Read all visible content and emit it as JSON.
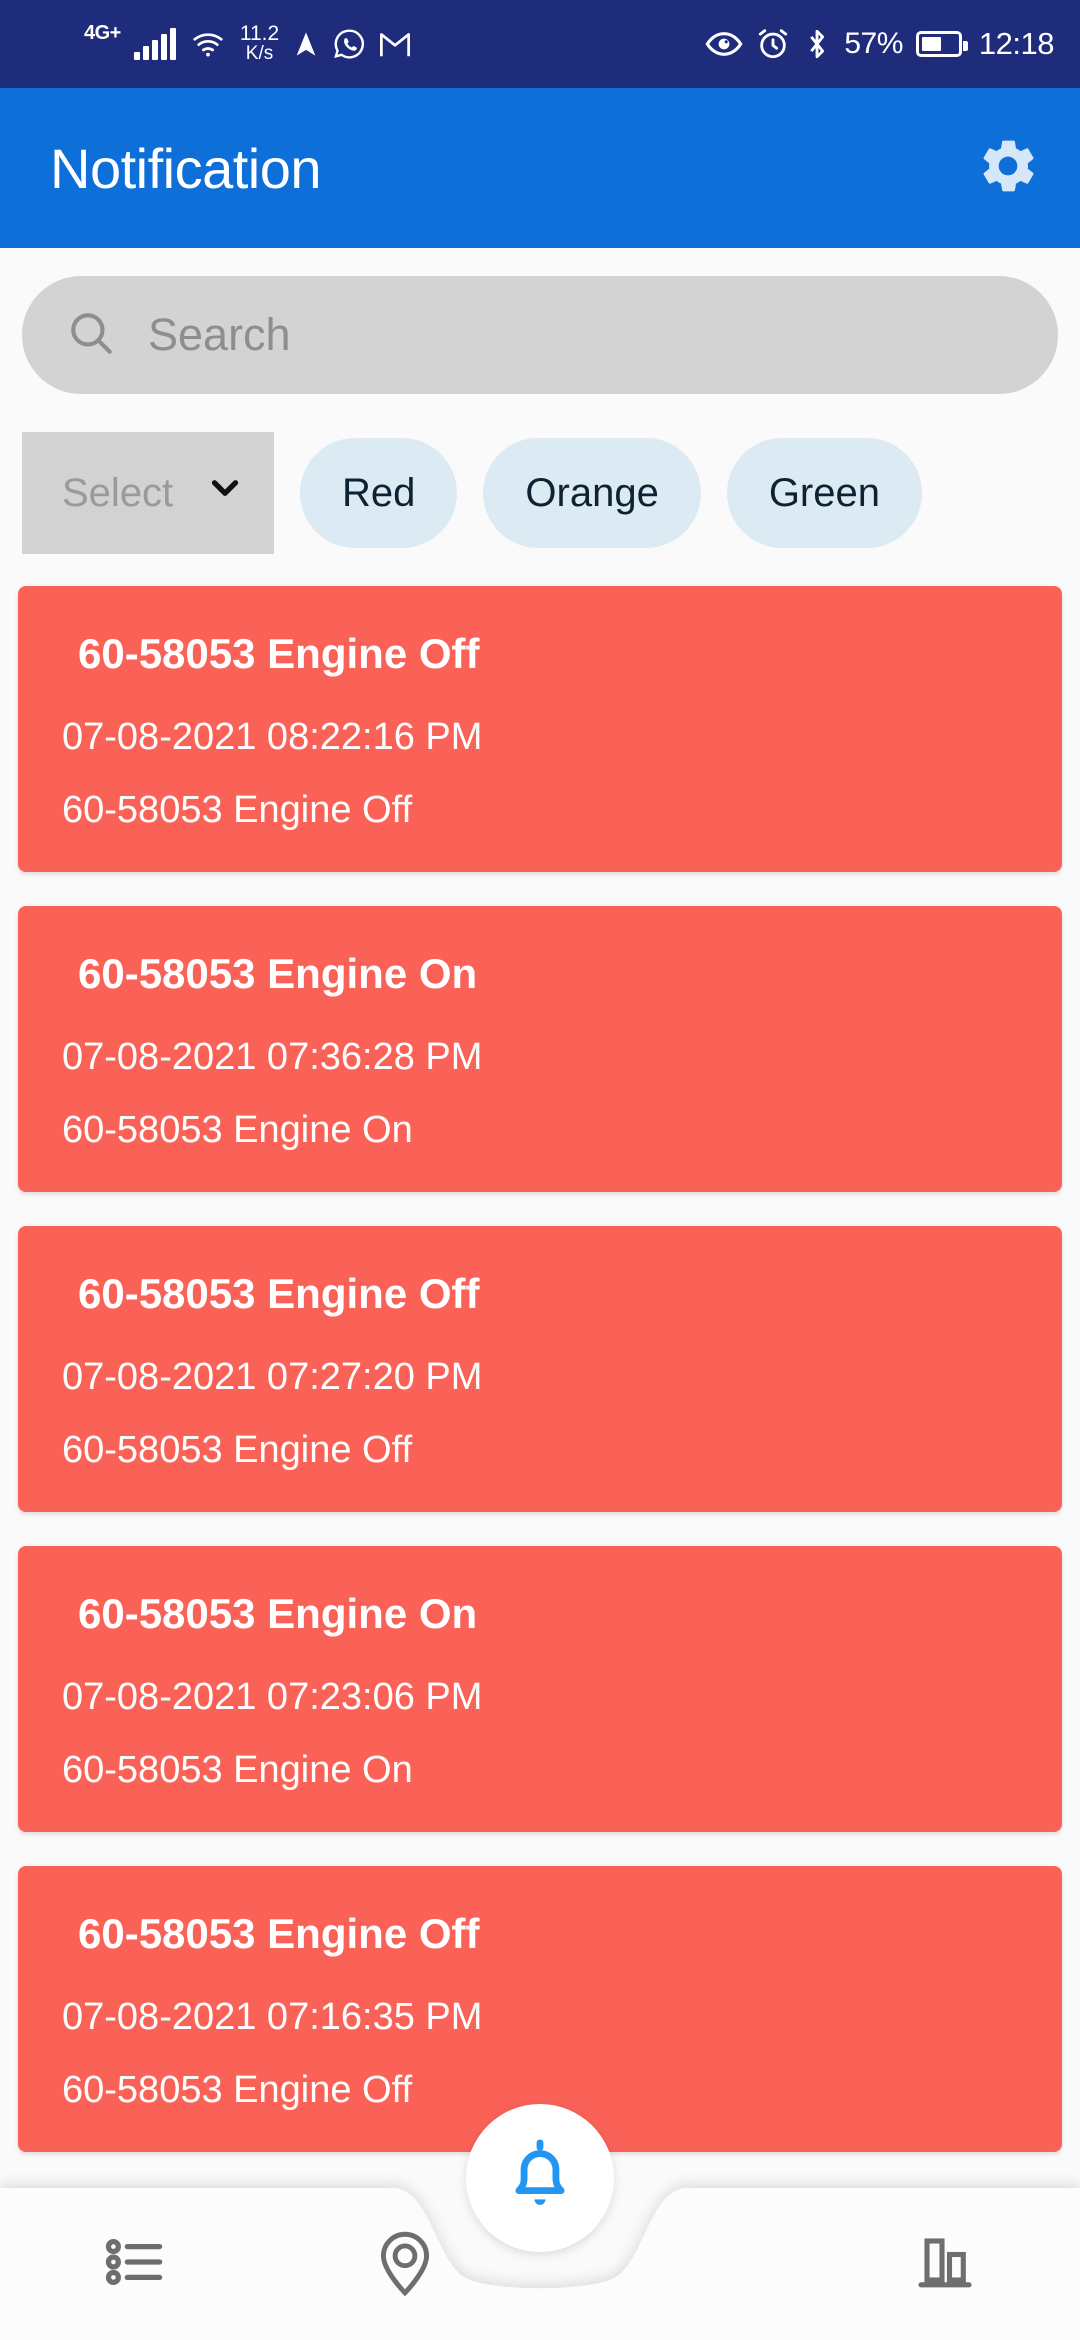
{
  "statusbar": {
    "network_label": "4G+",
    "signal_icon": "signal-bars-icon",
    "wifi_icon": "wifi-icon",
    "data_speed_value": "11.2",
    "data_speed_unit": "K/s",
    "navigation_icon": "navigation-arrow-icon",
    "whatsapp_icon": "whatsapp-icon",
    "gmail_icon": "gmail-icon",
    "eye_icon": "eye-icon",
    "alarm_icon": "alarm-clock-icon",
    "bluetooth_icon": "bluetooth-icon",
    "battery_percent": "57%",
    "battery_icon": "battery-icon",
    "clock": "12:18",
    "background_color": "#1f2b7b"
  },
  "appbar": {
    "title": "Notification",
    "settings_icon": "gear-icon",
    "background_color": "#0f6fd8"
  },
  "search": {
    "placeholder": "Search",
    "value": "",
    "icon": "search-icon"
  },
  "filters": {
    "select_label": "Select",
    "select_value": "",
    "chevron_icon": "chevron-down-icon",
    "chips": [
      {
        "label": "Red"
      },
      {
        "label": "Orange"
      },
      {
        "label": "Green"
      }
    ],
    "chip_color": "#dceaf4"
  },
  "notifications": {
    "card_color": "#fa6258",
    "items": [
      {
        "title": "60-58053 Engine Off",
        "timestamp": "07-08-2021 08:22:16 PM",
        "body": "60-58053 Engine Off"
      },
      {
        "title": "60-58053 Engine On",
        "timestamp": "07-08-2021 07:36:28 PM",
        "body": "60-58053 Engine On"
      },
      {
        "title": "60-58053 Engine Off",
        "timestamp": "07-08-2021 07:27:20 PM",
        "body": "60-58053 Engine Off"
      },
      {
        "title": "60-58053 Engine On",
        "timestamp": "07-08-2021 07:23:06 PM",
        "body": "60-58053 Engine On"
      },
      {
        "title": "60-58053 Engine Off",
        "timestamp": "07-08-2021 07:16:35 PM",
        "body": "60-58053 Engine Off"
      }
    ]
  },
  "bottomnav": {
    "items": [
      {
        "icon": "list-icon"
      },
      {
        "icon": "location-pin-icon"
      },
      {
        "icon": "bar-chart-icon"
      }
    ],
    "fab_icon": "bell-icon",
    "fab_color": "#2196f3"
  }
}
